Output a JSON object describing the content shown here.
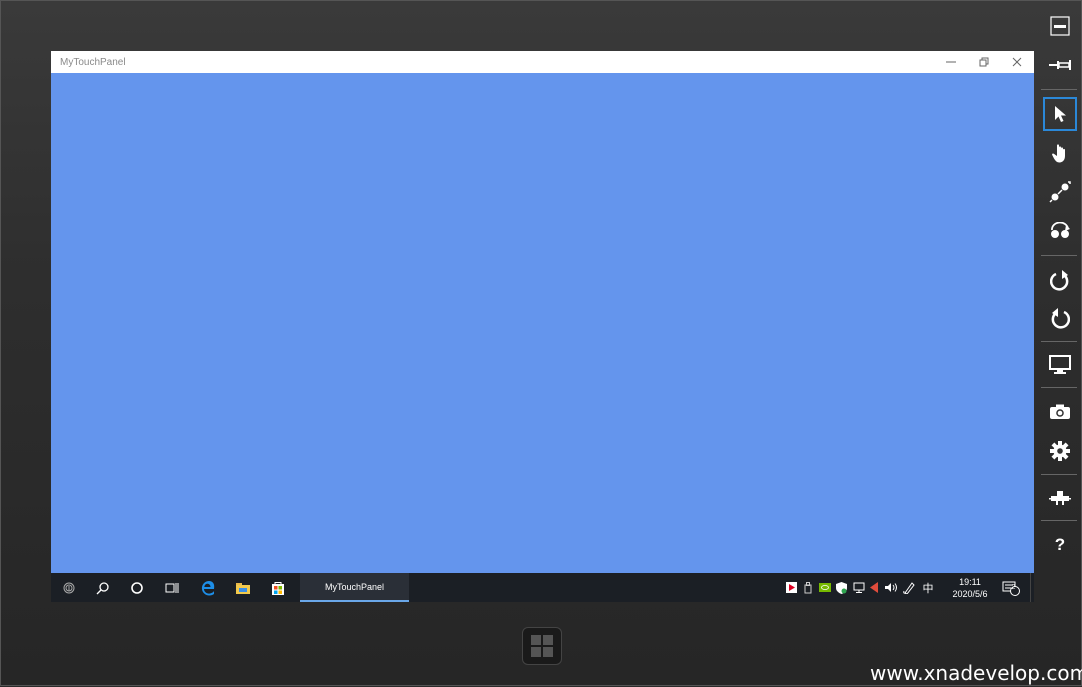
{
  "window": {
    "title": "MyTouchPanel",
    "background_color": "#6495ed"
  },
  "taskbar": {
    "icons": [
      "fingerprint-icon",
      "search-icon",
      "cortana-icon",
      "task-view-icon",
      "edge-icon",
      "file-explorer-icon",
      "store-icon"
    ],
    "active_app": "MyTouchPanel",
    "tray": {
      "ime": "中",
      "time": "19:11",
      "date": "2020/5/6",
      "notification_count": "2"
    }
  },
  "simulator_toolbar": {
    "tools": [
      "minimize",
      "pin",
      "mouse-mode",
      "touch-mode",
      "pinch-zoom",
      "rotate-touch",
      "rotate-clockwise",
      "rotate-counterclockwise",
      "change-resolution",
      "screenshot",
      "settings",
      "network",
      "help"
    ],
    "active_tool": "mouse-mode",
    "help_label": "?"
  },
  "watermark": "www.xnadevelop.com"
}
